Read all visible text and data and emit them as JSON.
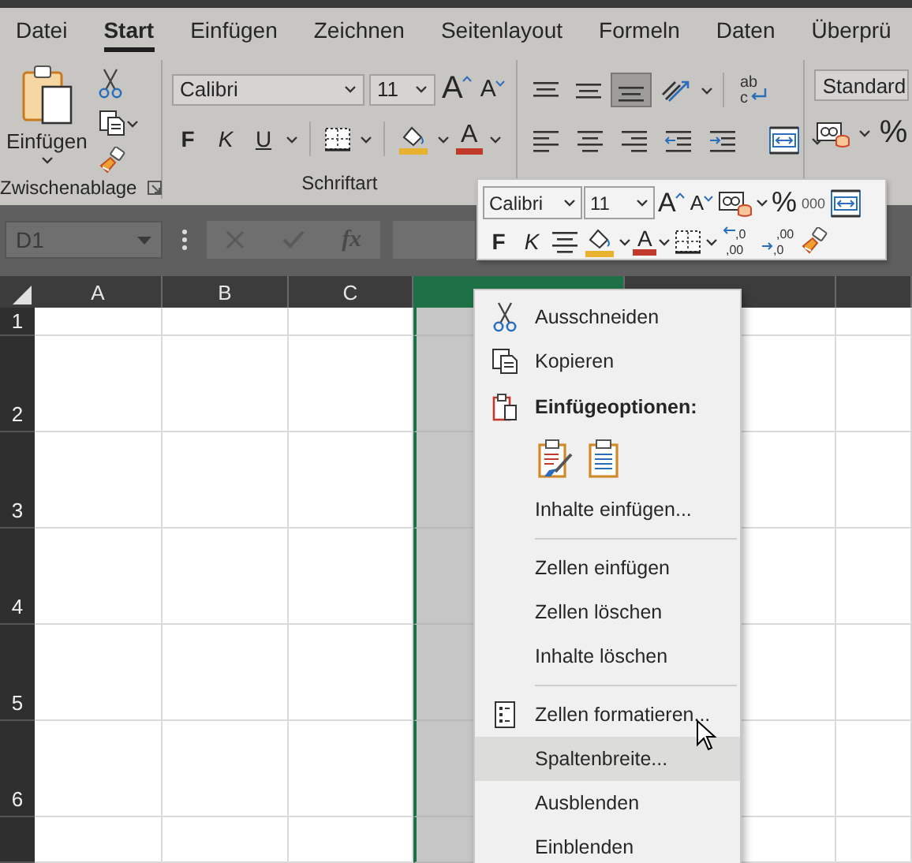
{
  "tabs": [
    {
      "label": "Datei",
      "selected": false
    },
    {
      "label": "Start",
      "selected": true
    },
    {
      "label": "Einfügen",
      "selected": false
    },
    {
      "label": "Zeichnen",
      "selected": false
    },
    {
      "label": "Seitenlayout",
      "selected": false
    },
    {
      "label": "Formeln",
      "selected": false
    },
    {
      "label": "Daten",
      "selected": false
    },
    {
      "label": "Überprü",
      "selected": false
    }
  ],
  "ribbon": {
    "clipboard": {
      "paste_label": "Einfügen",
      "group_label": "Zwischenablage"
    },
    "font": {
      "font_name": "Calibri",
      "font_size": "11",
      "grow_glyph": "A",
      "shrink_glyph": "A",
      "bold": "F",
      "italic": "K",
      "underline": "U",
      "font_color_glyph": "A",
      "group_label": "Schriftart"
    },
    "alignment": {
      "wrap_glyphs": [
        "ab",
        "c"
      ],
      "tools": [
        {
          "kind": "align-top",
          "selected": false
        },
        {
          "kind": "align-middle",
          "selected": false
        },
        {
          "kind": "align-bottom",
          "selected": true
        },
        {
          "kind": "orientation",
          "selected": false
        },
        {
          "kind": "wrap",
          "selected": false
        },
        {
          "kind": "align-left",
          "selected": false
        },
        {
          "kind": "align-center",
          "selected": false
        },
        {
          "kind": "align-right",
          "selected": false
        },
        {
          "kind": "indent-decrease",
          "selected": false
        },
        {
          "kind": "indent-increase",
          "selected": false
        },
        {
          "kind": "merge",
          "selected": false
        }
      ]
    },
    "number": {
      "format": "Standard",
      "percent": "%"
    }
  },
  "formula_bar": {
    "name_box": "D1",
    "function_glyph": "fx"
  },
  "grid": {
    "columns": [
      {
        "label": "A",
        "selected": false
      },
      {
        "label": "B",
        "selected": false
      },
      {
        "label": "C",
        "selected": false
      },
      {
        "selected": true
      },
      {
        "selected": false
      }
    ],
    "rows": [
      {
        "label": "1"
      },
      {
        "label": "2"
      },
      {
        "label": "3"
      },
      {
        "label": "4"
      },
      {
        "label": "5"
      },
      {
        "label": "6"
      }
    ]
  },
  "mini_toolbar": {
    "font_name": "Calibri",
    "font_size": "11",
    "grow_glyph": "A",
    "shrink_glyph": "A",
    "percent": "%",
    "thousands": "000",
    "bold": "F",
    "italic": "K",
    "font_color_glyph": "A",
    "decimal_increase": [
      ",0",
      ",00"
    ],
    "decimal_decrease": [
      ",00",
      ",0"
    ]
  },
  "context_menu": {
    "items": [
      {
        "kind": "cut",
        "label": "Ausschneiden",
        "hovered": false
      },
      {
        "kind": "copy",
        "label": "Kopieren",
        "hovered": false
      },
      {
        "kind": "header",
        "label": "Einfügeoptionen:"
      },
      {
        "kind": "paste_options"
      },
      {
        "kind": "item",
        "label": "Inhalte einfügen...",
        "hovered": false
      },
      {
        "kind": "separator"
      },
      {
        "kind": "item",
        "label": "Zellen einfügen",
        "hovered": false
      },
      {
        "kind": "item",
        "label": "Zellen löschen",
        "hovered": false
      },
      {
        "kind": "item",
        "label": "Inhalte löschen",
        "hovered": false
      },
      {
        "kind": "separator"
      },
      {
        "kind": "format",
        "label": "Zellen formatieren...",
        "hovered": false
      },
      {
        "kind": "item",
        "label": "Spaltenbreite...",
        "hovered": true
      },
      {
        "kind": "item",
        "label": "Ausblenden",
        "hovered": false
      },
      {
        "kind": "item",
        "label": "Einblenden",
        "hovered": false
      }
    ]
  }
}
